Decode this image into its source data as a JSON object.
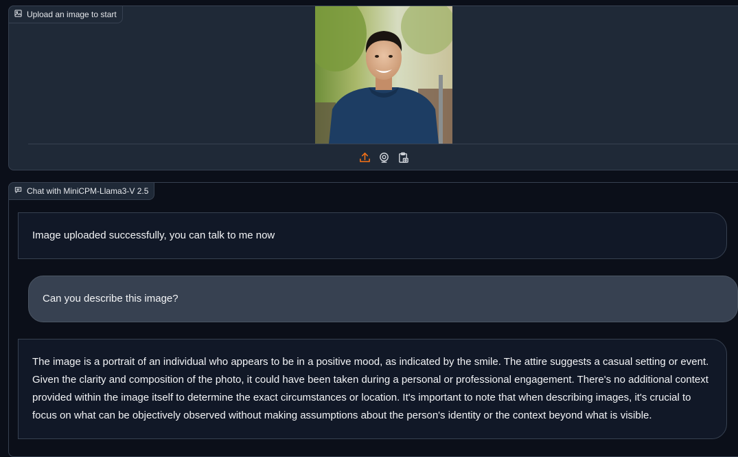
{
  "upload_panel": {
    "label": "Upload an image to start",
    "label_icon": "image-icon",
    "toolbar": [
      {
        "name": "upload-icon",
        "color": "#f97316"
      },
      {
        "name": "webcam-icon",
        "color": "#d1d5db"
      },
      {
        "name": "clipboard-icon",
        "color": "#d1d5db"
      }
    ]
  },
  "chat_panel": {
    "label": "Chat with MiniCPM-Llama3-V 2.5",
    "label_icon": "chat-icon",
    "messages": [
      {
        "role": "bot",
        "text": "Image uploaded successfully, you can talk to me now"
      },
      {
        "role": "user",
        "text": "Can you describe this image?"
      },
      {
        "role": "bot",
        "text": "The image is a portrait of an individual who appears to be in a positive mood, as indicated by the smile. The attire suggests a casual setting or event. Given the clarity and composition of the photo, it could have been taken during a personal or professional engagement. There's no additional context provided within the image itself to determine the exact circumstances or location. It's important to note that when describing images, it's crucial to focus on what can be objectively observed without making assumptions about the person's identity or the context beyond what is visible."
      }
    ]
  },
  "colors": {
    "background": "#0b0f19",
    "panel": "#1f2937",
    "border": "#374151",
    "accent": "#f97316",
    "user_bubble": "#374151",
    "bot_bubble": "#111827"
  }
}
